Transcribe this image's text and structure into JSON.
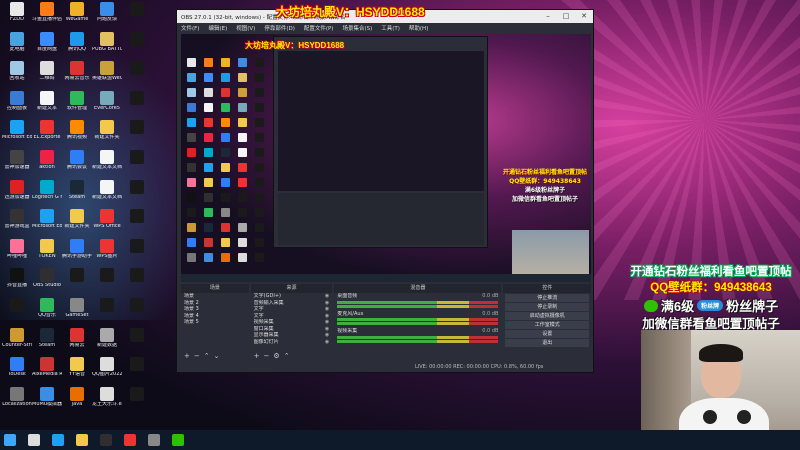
{
  "desktop_icons": [
    {
      "label": "FZDD",
      "color": "#e8e8e8"
    },
    {
      "label": "斗鱼直播伴侣",
      "color": "#ff7a18"
    },
    {
      "label": "WeGame",
      "color": "#f0b028"
    },
    {
      "label": "问题反馈",
      "color": "#3a8ee6"
    },
    {
      "label": "",
      "color": "#1a1a1a"
    },
    {
      "label": "此电脑",
      "color": "#4aa3df"
    },
    {
      "label": "百度网盘",
      "color": "#3b8cff"
    },
    {
      "label": "腾讯QQ",
      "color": "#1e9be8"
    },
    {
      "label": "PUBG BATTLEGROUNDS",
      "color": "#e0c060"
    },
    {
      "label": "",
      "color": "#1a1a1a"
    },
    {
      "label": "回收站",
      "color": "#9fc7e6"
    },
    {
      "label": "二维码",
      "color": "#dddddd"
    },
    {
      "label": "网易云音乐",
      "color": "#d33"
    },
    {
      "label": "英雄联盟WeGame版",
      "color": "#c9a13b"
    },
    {
      "label": "",
      "color": "#1a1a1a"
    },
    {
      "label": "控制面板",
      "color": "#3a7bd5"
    },
    {
      "label": "新建文本",
      "color": "#f5f5f5"
    },
    {
      "label": "软件管理",
      "color": "#2dba5a"
    },
    {
      "label": "EverCore5",
      "color": "#7ab"
    },
    {
      "label": "",
      "color": "#1a1a1a"
    },
    {
      "label": "Microsoft Edge",
      "color": "#1da1f2"
    },
    {
      "label": "EL.Exporte",
      "color": "#e33"
    },
    {
      "label": "腾讯视频",
      "color": "#ff8a00"
    },
    {
      "label": "新建文件夹",
      "color": "#f2c94c"
    },
    {
      "label": "",
      "color": "#1a1a1a"
    },
    {
      "label": "雷神加速器",
      "color": "#444"
    },
    {
      "label": "aktion",
      "color": "#e24"
    },
    {
      "label": "腾讯会议",
      "color": "#2f7ef5"
    },
    {
      "label": "新建文本文档",
      "color": "#f5f5f5"
    },
    {
      "label": "",
      "color": "#1a1a1a"
    },
    {
      "label": "迅游加速器",
      "color": "#d22"
    },
    {
      "label": "Logitech G HUB",
      "color": "#0ac"
    },
    {
      "label": "Steam",
      "color": "#1b2838"
    },
    {
      "label": "新建文本文档",
      "color": "#f5f5f5"
    },
    {
      "label": "",
      "color": "#1a1a1a"
    },
    {
      "label": "雷神游戏盒",
      "color": "#333"
    },
    {
      "label": "Microsoft Edge",
      "color": "#1da1f2"
    },
    {
      "label": "新建文件夹",
      "color": "#f2c94c"
    },
    {
      "label": "WPS Office",
      "color": "#e33"
    },
    {
      "label": "",
      "color": "#1a1a1a"
    },
    {
      "label": "哔哩哔哩",
      "color": "#fb7299"
    },
    {
      "label": "TOKEN",
      "color": "#f2c94c"
    },
    {
      "label": "腾讯手游助手",
      "color": "#2f7ef5"
    },
    {
      "label": "WPS图片",
      "color": "#e33"
    },
    {
      "label": "",
      "color": "#1a1a1a"
    },
    {
      "label": "抖音直播",
      "color": "#111"
    },
    {
      "label": "OBS Studio",
      "color": "#302e31"
    },
    {
      "label": "",
      "color": "#1a1a1a"
    },
    {
      "label": "",
      "color": "#1a1a1a"
    },
    {
      "label": "",
      "color": "#1a1a1a"
    },
    {
      "label": "",
      "color": "#1a1a1a"
    },
    {
      "label": "QQ音乐",
      "color": "#2dba5a"
    },
    {
      "label": "GameSet",
      "color": "#888"
    },
    {
      "label": "",
      "color": "#1a1a1a"
    },
    {
      "label": "",
      "color": "#1a1a1a"
    },
    {
      "label": "Counter-Strike",
      "color": "#c93"
    },
    {
      "label": "Steam",
      "color": "#1b2838"
    },
    {
      "label": "网易云",
      "color": "#d33"
    },
    {
      "label": "新建数据",
      "color": "#aaa"
    },
    {
      "label": "",
      "color": "#1a1a1a"
    },
    {
      "label": "ToDesk",
      "color": "#2f7ef5"
    },
    {
      "label": "AlxeMedia RsCentral 4",
      "color": "#c33"
    },
    {
      "label": "YY语音",
      "color": "#f2c94c"
    },
    {
      "label": "QQ图片20220721094506",
      "color": "#ddd"
    },
    {
      "label": "",
      "color": "#1a1a1a"
    },
    {
      "label": "Localization",
      "color": "#777"
    },
    {
      "label": "MuMu模拟器",
      "color": "#3a8ee6"
    },
    {
      "label": "java",
      "color": "#e76f00"
    },
    {
      "label": "龙王大乐斗.exe",
      "color": "#ddd"
    },
    {
      "label": "",
      "color": "#1a1a1a"
    }
  ],
  "obs": {
    "window_title": "OBS 27.0.1 (32-bit, windows) - 配置文件: 未命名 - 场景: 未命名",
    "overlay_title": "大坊培丸殿V：HSYDD1688",
    "menu": [
      "文件(F)",
      "编辑(E)",
      "视图(V)",
      "停靠部件(D)",
      "配置文件(P)",
      "场景集合(S)",
      "工具(T)",
      "帮助(H)"
    ],
    "preview_title": "大坊培丸殿V：HSYDD1688",
    "preview_promo": [
      "开通钻石粉丝福利看鱼吧置顶帖",
      "QQ壁纸群：949438643",
      "满6级粉丝牌子",
      "加微信群看鱼吧置顶帖子"
    ],
    "source_bar": "来源设置",
    "docks": {
      "scenes": {
        "header": "场景",
        "items": [
          "场景",
          "场景 2",
          "场景 3",
          "场景 4",
          "场景 5"
        ]
      },
      "sources": {
        "header": "来源",
        "items": [
          "文字(GDI+)",
          "音频输入采集",
          "文字",
          "文字",
          "视频采集",
          "窗口采集",
          "显示器采集",
          "图像幻灯片"
        ]
      },
      "mixer": {
        "header": "混音器",
        "tracks": [
          {
            "name": "桌面音频",
            "level": "0.0 dB"
          },
          {
            "name": "麦克风/Aux",
            "level": "0.0 dB"
          },
          {
            "name": "视频采集",
            "level": "0.0 dB"
          }
        ]
      },
      "controls": {
        "header": "控件",
        "buttons": [
          "停止推流",
          "停止录制",
          "启动虚拟摄像机",
          "工作室模式",
          "设置",
          "退出"
        ]
      }
    },
    "status": "LIVE: 00:00:00   REC: 00:00:00   CPU: 0.8%, 60.00 fps"
  },
  "promo": {
    "line1": "开通钻石粉丝福利看鱼吧置顶帖",
    "line2": "QQ壁纸群：949438643",
    "line3_text": "满6级",
    "line3_badge": "粉丝牌",
    "line3_tail": "粉丝牌子",
    "line4": "加微信群看鱼吧置顶帖子"
  },
  "taskbar": [
    {
      "name": "windows-start-icon",
      "color": "#3ea6ff"
    },
    {
      "name": "search-icon",
      "color": "#dddddd"
    },
    {
      "name": "edge-icon",
      "color": "#1da1f2"
    },
    {
      "name": "explorer-icon",
      "color": "#f2c94c"
    },
    {
      "name": "obs-taskbar-icon",
      "color": "#302e31"
    },
    {
      "name": "chrome-icon",
      "color": "#e33"
    },
    {
      "name": "game-icon",
      "color": "#888"
    },
    {
      "name": "wechat-taskbar-icon",
      "color": "#2dc100"
    }
  ]
}
